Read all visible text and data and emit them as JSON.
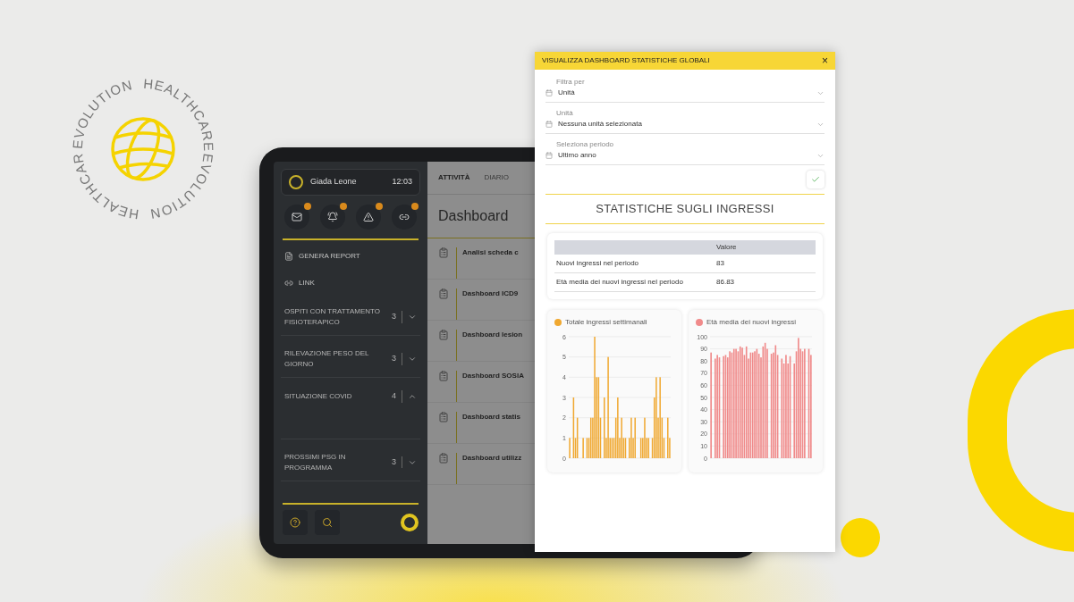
{
  "badge": {
    "words": [
      "EVOLUTION",
      "HEALTHCARE",
      "HEALTHCARE",
      "EVOLUTION"
    ]
  },
  "sidebar": {
    "user": {
      "name": "Giada Leone",
      "time": "12:03"
    },
    "shortcuts": [
      {
        "kind": "mail"
      },
      {
        "kind": "bell"
      },
      {
        "kind": "warning"
      },
      {
        "kind": "link"
      }
    ],
    "sections": [
      {
        "kind": "report",
        "label": "GENERA REPORT"
      },
      {
        "kind": "link",
        "label": "LINK"
      }
    ],
    "groups": [
      {
        "label": "OSPITI CON TRATTAMENTO FISIOTERAPICO",
        "count": "3",
        "expanded": false
      },
      {
        "label": "RILEVAZIONE PESO DEL GIORNO",
        "count": "3",
        "expanded": false
      },
      {
        "label": "SITUAZIONE COVID",
        "count": "4",
        "expanded": true
      },
      {
        "label": "PROSSIMI PSG IN PROGRAMMA",
        "count": "3",
        "expanded": false
      }
    ]
  },
  "main": {
    "tabs": [
      {
        "label": "ATTIVITÀ",
        "selected": true
      },
      {
        "label": "DIARIO",
        "selected": false
      }
    ],
    "title": "Dashboard",
    "items": [
      {
        "title": "Analisi scheda c"
      },
      {
        "title": "Dashboard ICD9"
      },
      {
        "title": "Dashboard lesion"
      },
      {
        "title": "Dashboard SOSIA"
      },
      {
        "title": "Dashboard statis"
      },
      {
        "title": "Dashboard utilizz"
      }
    ]
  },
  "modal": {
    "title": "VISUALIZZA DASHBOARD STATISTICHE GLOBALI",
    "close": "×",
    "fields": [
      {
        "label": "Filtra per",
        "value": "Unità"
      },
      {
        "label": "Unità",
        "value": "Nessuna unità selezionata"
      },
      {
        "label": "Seleziona periodo",
        "value": "Ultimo anno"
      }
    ],
    "heading": "STATISTICHE SUGLI INGRESSI",
    "table": {
      "columns": [
        "Valore"
      ],
      "rows": [
        {
          "label": "Nuovi ingressi nel periodo",
          "value": "83"
        },
        {
          "label": "Età media dei nuovi ingressi nel periodo",
          "value": "86.83"
        }
      ]
    },
    "charts": [
      {
        "chart_data": {
          "type": "bar",
          "grid": true,
          "yticks": [
            0,
            1,
            2,
            3,
            4,
            5,
            6
          ],
          "ylim": [
            0,
            6
          ],
          "series": [
            {
              "name": "Totale ingressi settimanali",
              "color": "#f0a830",
              "values": [
                1,
                0,
                3,
                1,
                2,
                0,
                0,
                1,
                0,
                1,
                1,
                2,
                2,
                6,
                4,
                4,
                2,
                0,
                3,
                1,
                5,
                1,
                1,
                1,
                2,
                3,
                1,
                2,
                1,
                1,
                0,
                1,
                2,
                1,
                2,
                0,
                0,
                1,
                1,
                2,
                1,
                1,
                0,
                1,
                3,
                4,
                2,
                4,
                2,
                1,
                0,
                2,
                1
              ]
            }
          ]
        }
      },
      {
        "chart_data": {
          "type": "bar",
          "grid": true,
          "yticks": [
            0,
            10,
            20,
            30,
            40,
            50,
            60,
            70,
            80,
            90,
            100
          ],
          "ylim": [
            0,
            100
          ],
          "series": [
            {
              "name": "Età media dei nuovi ingressi",
              "color": "#f08a8a",
              "values": [
                87,
                0,
                82,
                85,
                83,
                0,
                84,
                85,
                83,
                88,
                87,
                90,
                90,
                88,
                92,
                91,
                85,
                92,
                82,
                87,
                87,
                88,
                90,
                86,
                83,
                92,
                95,
                90,
                0,
                86,
                87,
                93,
                85,
                0,
                82,
                78,
                85,
                78,
                84,
                0,
                78,
                88,
                99,
                90,
                88,
                90,
                0,
                90,
                85
              ]
            }
          ]
        }
      }
    ]
  }
}
